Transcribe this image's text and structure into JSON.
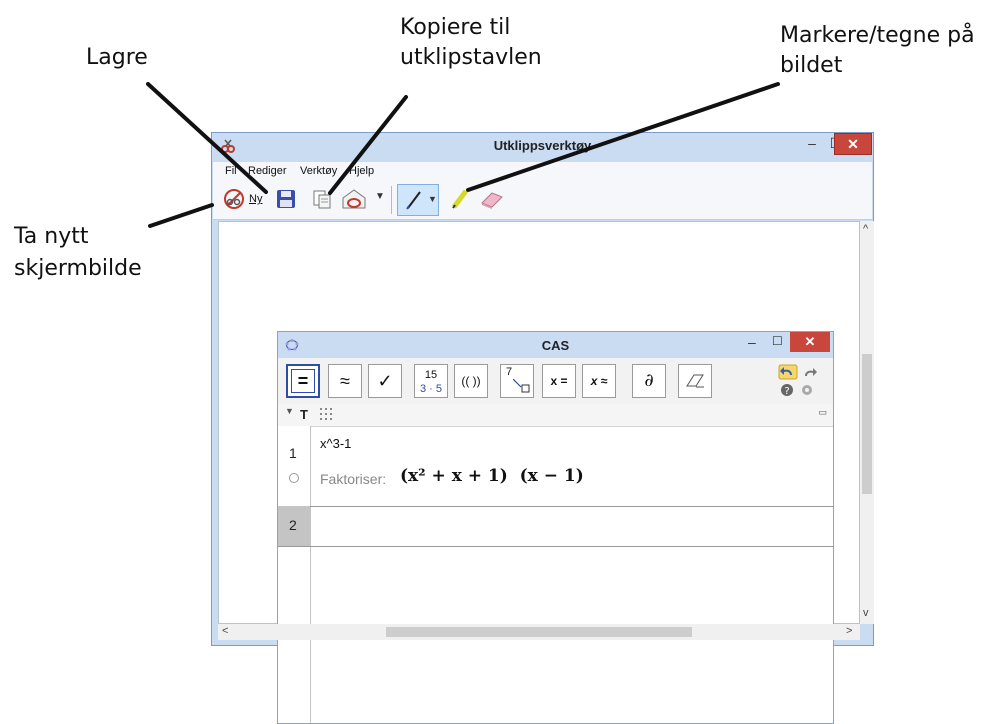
{
  "annotations": {
    "lagre": "Lagre",
    "kopiere_line1": "Kopiere til",
    "kopiere_line2": "utklipstavlen",
    "markere_line1": "Markere/tegne på",
    "markere_line2": "bildet",
    "nytt_line1": "Ta nytt",
    "nytt_line2": "skjermbilde"
  },
  "window": {
    "title": "Utklippsverktøy",
    "menu": [
      "Fil",
      "Rediger",
      "Verktøy",
      "Hjelp"
    ],
    "toolbar": {
      "new_label": "Ny"
    }
  },
  "cas": {
    "title": "CAS",
    "tools": {
      "evaluate": "=",
      "numeric": "≈",
      "check": "✓",
      "factor_top": "15",
      "factor_bottom": "3 · 5",
      "expand": "(( ))",
      "substitute": "7",
      "solve": "x =",
      "nsolve": "x ≈",
      "derivative": "∂"
    },
    "style_text": "T",
    "rows": [
      {
        "number": "1",
        "input": "x^3-1",
        "output_label": "Faktoriser:",
        "output_math": "(x² + x + 1)  (x − 1)"
      },
      {
        "number": "2",
        "input": ""
      }
    ]
  },
  "colors": {
    "title_bar": "#c9dcf2",
    "close_button": "#c9463d",
    "accent": "#2c4ea8"
  }
}
